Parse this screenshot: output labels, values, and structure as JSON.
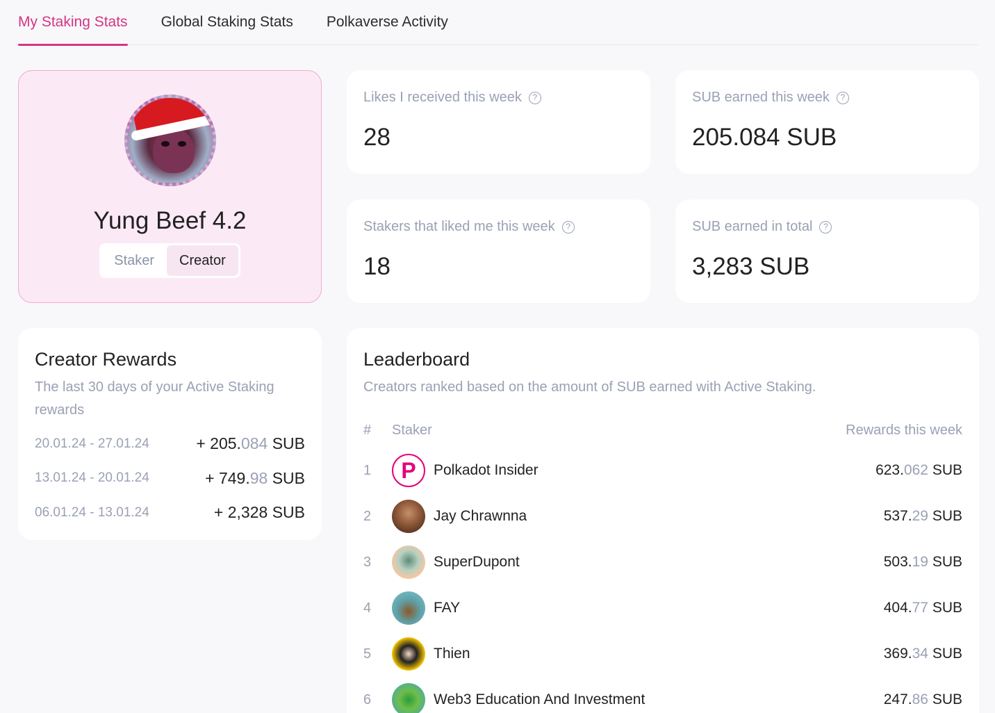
{
  "tabs": [
    {
      "label": "My Staking Stats",
      "active": true
    },
    {
      "label": "Global Staking Stats",
      "active": false
    },
    {
      "label": "Polkaverse Activity",
      "active": false
    }
  ],
  "profile": {
    "name": "Yung Beef 4.2",
    "roles": [
      "Staker",
      "Creator"
    ],
    "active_role": "Creator"
  },
  "stats": {
    "likes_week": {
      "label": "Likes I received this week",
      "value": "28"
    },
    "sub_week": {
      "label": "SUB earned this week",
      "value": "205.084 SUB"
    },
    "stakers_week": {
      "label": "Stakers that liked me this week",
      "value": "18"
    },
    "sub_total": {
      "label": "SUB earned in total",
      "value": "3,283 SUB"
    }
  },
  "rewards": {
    "title": "Creator Rewards",
    "subtitle": "The last 30 days of your Active Staking rewards",
    "rows": [
      {
        "date": "20.01.24 - 27.01.24",
        "prefix": "+ 205.",
        "muted": "084",
        "suffix": " SUB"
      },
      {
        "date": "13.01.24 - 20.01.24",
        "prefix": "+ 749.",
        "muted": "98",
        "suffix": " SUB"
      },
      {
        "date": "06.01.24 - 13.01.24",
        "prefix": "+ 2,328",
        "muted": "",
        "suffix": " SUB"
      }
    ]
  },
  "leaderboard": {
    "title": "Leaderboard",
    "subtitle": "Creators ranked based on the amount of SUB earned with Active Staking.",
    "col_rank": "#",
    "col_staker": "Staker",
    "col_rewards": "Rewards this week",
    "rows": [
      {
        "rank": "1",
        "name": "Polkadot Insider",
        "int": "623.",
        "dec": "062",
        "unit": " SUB"
      },
      {
        "rank": "2",
        "name": "Jay Chrawnna",
        "int": "537.",
        "dec": "29",
        "unit": " SUB"
      },
      {
        "rank": "3",
        "name": "SuperDupont",
        "int": "503.",
        "dec": "19",
        "unit": " SUB"
      },
      {
        "rank": "4",
        "name": "FAY",
        "int": "404.",
        "dec": "77",
        "unit": " SUB"
      },
      {
        "rank": "5",
        "name": "Thien",
        "int": "369.",
        "dec": "34",
        "unit": " SUB"
      },
      {
        "rank": "6",
        "name": "Web3 Education And Investment",
        "int": "247.",
        "dec": "86",
        "unit": " SUB"
      }
    ]
  },
  "colors": {
    "accent": "#d63384",
    "profile_bg": "#fbeaf5",
    "muted_text": "#9aa1b4"
  },
  "icons": {
    "help": "question-circle-icon"
  }
}
